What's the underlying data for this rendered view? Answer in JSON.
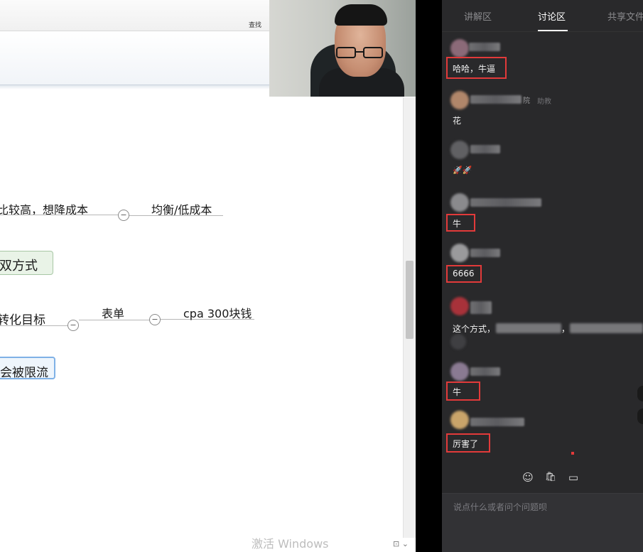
{
  "shared_screen": {
    "find_label": "查找",
    "watermark": "激活 Windows",
    "mindmap": {
      "row1_left": "比较高，想降成本",
      "row1_right": "均衡/低成本",
      "box1": "双方式",
      "row2_left": "转化目标",
      "row2_mid": "表单",
      "row2_right": "cpa 300块钱",
      "box2": "会被限流",
      "collapse_symbol": "−"
    },
    "status_corner": "⊡ ⌄"
  },
  "chat": {
    "tabs": [
      {
        "label": "讲解区",
        "active": false
      },
      {
        "label": "讨论区",
        "active": true
      },
      {
        "label": "共享文件",
        "active": false
      }
    ],
    "messages": [
      {
        "text": "哈哈，牛逼",
        "highlighted": true
      },
      {
        "text": "花",
        "highlighted": false,
        "badge_prefix": "院",
        "badge": "助教"
      },
      {
        "text": "🚀🚀",
        "highlighted": false
      },
      {
        "text": "牛",
        "highlighted": true
      },
      {
        "text": "6666",
        "highlighted": true
      },
      {
        "text": "这个方式，",
        "highlighted": false,
        "trail": "，"
      },
      {
        "text": "牛",
        "highlighted": true
      },
      {
        "text": "厉害了",
        "highlighted": true
      }
    ],
    "toolbar": {
      "emoji_icon": "☺",
      "bag_icon": "🛍",
      "card_icon": "▭"
    },
    "input_placeholder": "说点什么或者问个问题呗"
  }
}
